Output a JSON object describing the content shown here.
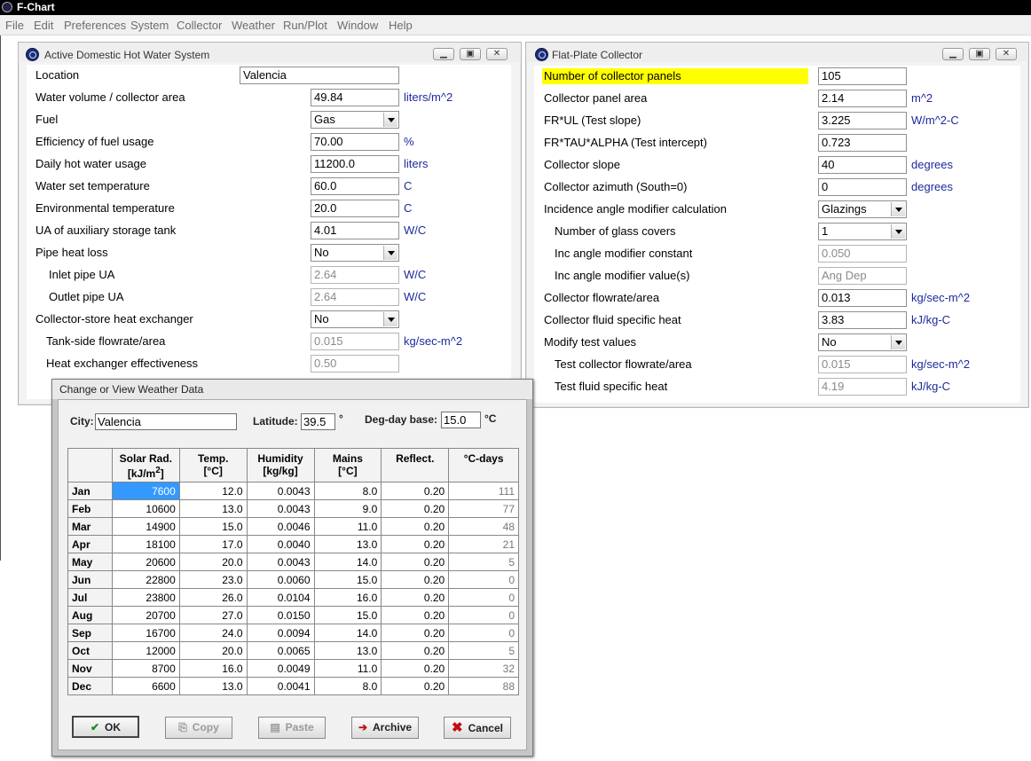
{
  "app": {
    "title": "F-Chart"
  },
  "menu": [
    "File",
    "Edit",
    "Preferences",
    "System",
    "Collector",
    "Weather",
    "Run/Plot",
    "Window",
    "Help"
  ],
  "dhw": {
    "title": "Active Domestic Hot Water System",
    "location_label": "Location",
    "location_value": "Valencia",
    "rows": [
      {
        "label": "Water volume / collector area",
        "value": "49.84",
        "unit": "liters/m^2"
      },
      {
        "label": "Fuel",
        "value": "Gas",
        "unit": ""
      },
      {
        "label": "Efficiency of fuel usage",
        "value": "70.00",
        "unit": "%"
      },
      {
        "label": "Daily hot water usage",
        "value": "11200.0",
        "unit": "liters"
      },
      {
        "label": "Water set temperature",
        "value": "60.0",
        "unit": "C"
      },
      {
        "label": "Environmental temperature",
        "value": "20.0",
        "unit": "C"
      },
      {
        "label": "UA of auxiliary storage tank",
        "value": "4.01",
        "unit": "W/C"
      },
      {
        "label": "Pipe heat loss",
        "value": "No",
        "unit": ""
      },
      {
        "label": "Inlet pipe UA",
        "value": "2.64",
        "unit": "W/C"
      },
      {
        "label": "Outlet pipe UA",
        "value": "2.64",
        "unit": "W/C"
      },
      {
        "label": "Collector-store heat exchanger",
        "value": "No",
        "unit": ""
      },
      {
        "label": "Tank-side flowrate/area",
        "value": "0.015",
        "unit": "kg/sec-m^2"
      },
      {
        "label": "Heat exchanger effectiveness",
        "value": "0.50",
        "unit": ""
      }
    ]
  },
  "fpc": {
    "title": "Flat-Plate Collector",
    "rows": [
      {
        "label": "Number of collector panels",
        "value": "105",
        "unit": ""
      },
      {
        "label": "Collector panel area",
        "value": "2.14",
        "unit": "m^2"
      },
      {
        "label": "FR*UL (Test slope)",
        "value": "3.225",
        "unit": "W/m^2-C"
      },
      {
        "label": "FR*TAU*ALPHA (Test intercept)",
        "value": "0.723",
        "unit": ""
      },
      {
        "label": "Collector slope",
        "value": "40",
        "unit": "degrees"
      },
      {
        "label": "Collector azimuth (South=0)",
        "value": "0",
        "unit": "degrees"
      },
      {
        "label": "Incidence angle modifier calculation",
        "value": "Glazings",
        "unit": ""
      },
      {
        "label": "Number of glass covers",
        "value": "1",
        "unit": ""
      },
      {
        "label": "Inc angle modifier constant",
        "value": "0.050",
        "unit": ""
      },
      {
        "label": "Inc angle modifier value(s)",
        "value": "Ang Dep",
        "unit": ""
      },
      {
        "label": "Collector flowrate/area",
        "value": "0.013",
        "unit": "kg/sec-m^2"
      },
      {
        "label": "Collector fluid specific heat",
        "value": "3.83",
        "unit": "kJ/kg-C"
      },
      {
        "label": "Modify test values",
        "value": "No",
        "unit": ""
      },
      {
        "label": "Test collector flowrate/area",
        "value": "0.015",
        "unit": "kg/sec-m^2"
      },
      {
        "label": "Test fluid specific heat",
        "value": "4.19",
        "unit": "kJ/kg-C"
      }
    ]
  },
  "weather": {
    "title": "Change or View Weather Data",
    "city_label": "City:",
    "city_value": "Valencia",
    "lat_label": "Latitude:",
    "lat_value": "39.5",
    "lat_unit": "°",
    "dd_label": "Deg-day base:",
    "dd_value": "15.0",
    "dd_unit": "°C",
    "headers": [
      "Solar Rad.",
      "[kJ/m",
      "2",
      "]",
      "Temp.",
      "[°C]",
      "Humidity",
      "[kg/kg]",
      "Mains",
      "[°C]",
      "Reflect.",
      "°C-days"
    ],
    "rows": [
      [
        "Jan",
        "7600",
        "12.0",
        "0.0043",
        "8.0",
        "0.20",
        "111"
      ],
      [
        "Feb",
        "10600",
        "13.0",
        "0.0043",
        "9.0",
        "0.20",
        "77"
      ],
      [
        "Mar",
        "14900",
        "15.0",
        "0.0046",
        "11.0",
        "0.20",
        "48"
      ],
      [
        "Apr",
        "18100",
        "17.0",
        "0.0040",
        "13.0",
        "0.20",
        "21"
      ],
      [
        "May",
        "20600",
        "20.0",
        "0.0043",
        "14.0",
        "0.20",
        "5"
      ],
      [
        "Jun",
        "22800",
        "23.0",
        "0.0060",
        "15.0",
        "0.20",
        "0"
      ],
      [
        "Jul",
        "23800",
        "26.0",
        "0.0104",
        "16.0",
        "0.20",
        "0"
      ],
      [
        "Aug",
        "20700",
        "27.0",
        "0.0150",
        "15.0",
        "0.20",
        "0"
      ],
      [
        "Sep",
        "16700",
        "24.0",
        "0.0094",
        "14.0",
        "0.20",
        "0"
      ],
      [
        "Oct",
        "12000",
        "20.0",
        "0.0065",
        "13.0",
        "0.20",
        "5"
      ],
      [
        "Nov",
        "8700",
        "16.0",
        "0.0049",
        "11.0",
        "0.20",
        "32"
      ],
      [
        "Dec",
        "6600",
        "13.0",
        "0.0041",
        "8.0",
        "0.20",
        "88"
      ]
    ],
    "buttons": {
      "ok": "OK",
      "copy": "Copy",
      "paste": "Paste",
      "archive": "Archive",
      "cancel": "Cancel"
    }
  }
}
